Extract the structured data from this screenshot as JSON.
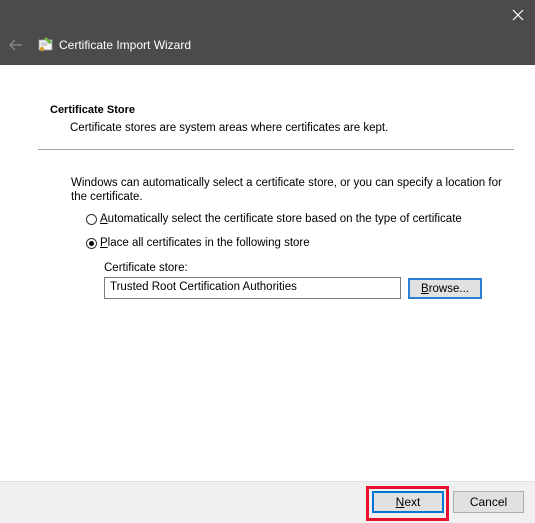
{
  "window": {
    "title": "Certificate Import Wizard"
  },
  "section": {
    "title": "Certificate Store",
    "description": "Certificate stores are system areas where certificates are kept."
  },
  "intro": "Windows can automatically select a certificate store, or you can specify a location for the certificate.",
  "options": [
    {
      "accel": "A",
      "rest": "utomatically select the certificate store based on the type of certificate",
      "checked": false
    },
    {
      "accel": "P",
      "rest": "lace all certificates in the following store",
      "checked": true
    }
  ],
  "store": {
    "label": "Certificate store:",
    "value": "Trusted Root Certification Authorities",
    "browse_accel": "B",
    "browse_rest": "rowse..."
  },
  "footer": {
    "next_accel": "N",
    "next_rest": "ext",
    "cancel_label": "Cancel"
  },
  "colors": {
    "titlebar": "#4b4b4b",
    "highlight": "#e8112d",
    "focus": "#0078d7"
  },
  "icons": {
    "close": "close-icon",
    "back": "back-arrow-icon",
    "app": "certificate-icon"
  }
}
